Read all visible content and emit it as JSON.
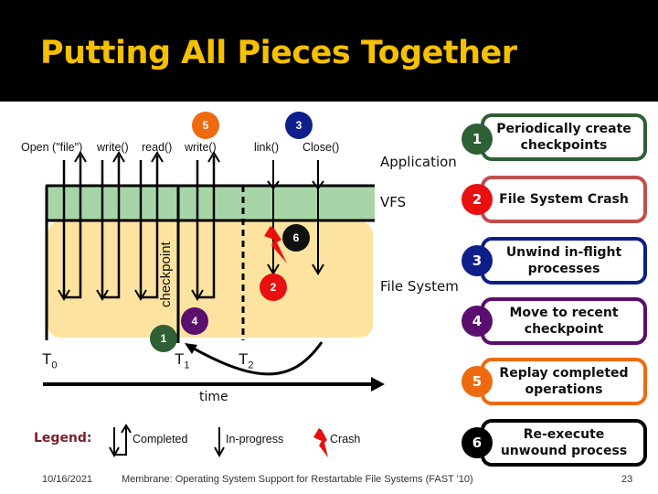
{
  "slide": {
    "title": "Putting All  Pieces Together",
    "date": "10/16/2021",
    "footer": "Membrane: Operating System Support for Restartable File Systems (FAST '10)",
    "page_number": "23"
  },
  "diagram": {
    "calls": [
      "Open (\"file\")",
      "write()",
      "read()",
      "write()",
      "link()",
      "Close()"
    ],
    "layers": {
      "application": "Application",
      "vfs": "VFS",
      "file_system": "File System"
    },
    "checkpoint_label": "checkpoint",
    "time_markers": [
      {
        "base": "T",
        "sub": "0"
      },
      {
        "base": "T",
        "sub": "1"
      },
      {
        "base": "T",
        "sub": "2"
      }
    ],
    "time_axis_label": "time",
    "badges": {
      "b1": "1",
      "b2": "2",
      "b3": "3",
      "b4": "4",
      "b5": "5",
      "b6": "6"
    },
    "colors": {
      "vfs": "#a8d5a8",
      "file_system": "#fde3a0",
      "step1": "#2f5f35",
      "step2": "#e81010",
      "step2_border": "#c0504d",
      "step3": "#0f1f8a",
      "step4": "#5a0f6e",
      "step5": "#ee6a10",
      "step6": "#000000",
      "crash": "#e81010"
    }
  },
  "steps": [
    {
      "number": "1",
      "text": "Periodically create checkpoints"
    },
    {
      "number": "2",
      "text": "File System Crash"
    },
    {
      "number": "3",
      "text": "Unwind in-flight processes"
    },
    {
      "number": "4",
      "text": "Move to recent checkpoint"
    },
    {
      "number": "5",
      "text": "Replay completed operations"
    },
    {
      "number": "6",
      "text": "Re-execute unwound process"
    }
  ],
  "legend": {
    "title": "Legend:",
    "completed": "Completed",
    "in_progress": "In-progress",
    "crash": "Crash"
  }
}
